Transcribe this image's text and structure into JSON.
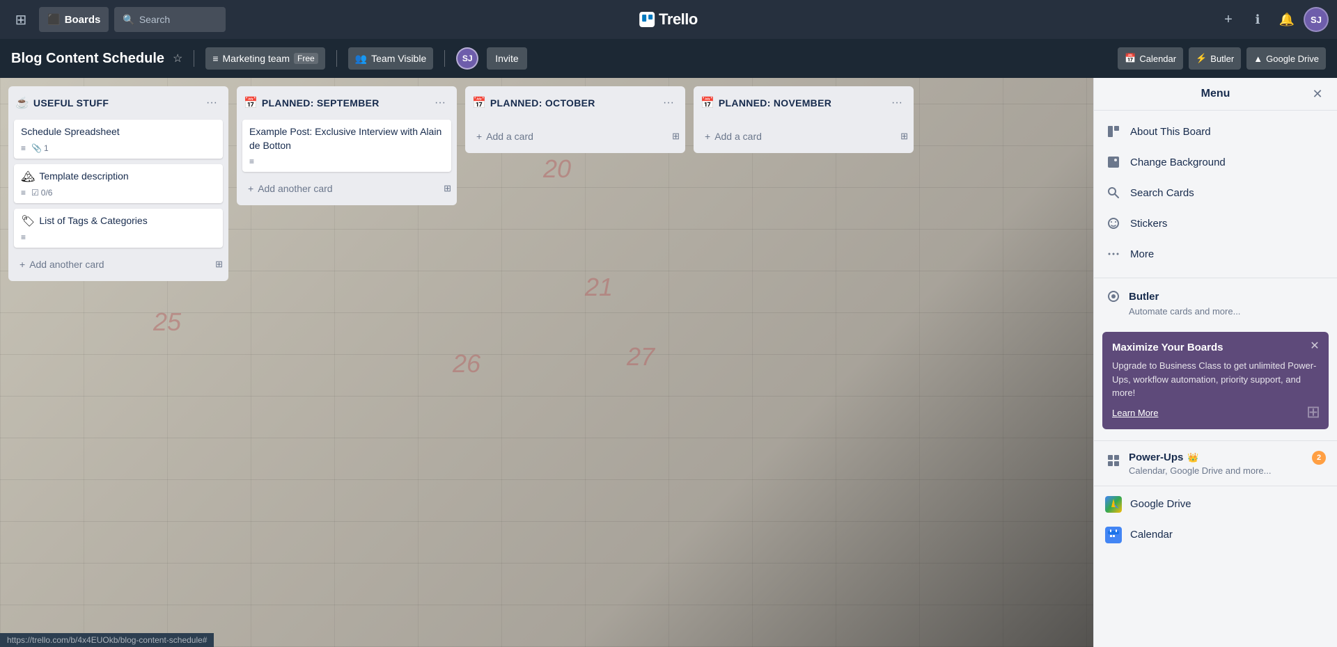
{
  "app": {
    "title": "Trello",
    "logo_text": "Trello"
  },
  "topnav": {
    "home_label": "Home",
    "boards_label": "Boards",
    "search_placeholder": "Search",
    "create_label": "+",
    "info_label": "ℹ",
    "notification_label": "🔔",
    "avatar_initials": "SJ"
  },
  "board": {
    "title": "Blog Content Schedule",
    "team_name": "Marketing team",
    "team_plan": "Free",
    "visibility": "Team Visible",
    "member_initials": "SJ",
    "invite_label": "Invite",
    "powerups": [
      {
        "label": "Calendar"
      },
      {
        "label": "Butler"
      },
      {
        "label": "Google Drive"
      }
    ]
  },
  "lists": [
    {
      "id": "useful-stuff",
      "icon": "☕",
      "title": "USEFUL STUFF",
      "cards": [
        {
          "id": "schedule-spreadsheet",
          "title": "Schedule Spreadsheet",
          "meta_icon_1": "≡",
          "meta_icon_2": "📎",
          "meta_count": "1"
        },
        {
          "id": "template-description",
          "icon": "🏔",
          "title": "Template description",
          "meta_icon_1": "≡",
          "meta_checklist": "0/6"
        },
        {
          "id": "list-of-tags",
          "icon": "🏷",
          "title": "List of Tags & Categories",
          "meta_icon_1": "≡"
        }
      ],
      "add_label": "Add another card"
    },
    {
      "id": "planned-sep",
      "icon": "📅",
      "title": "PLANNED: SEPTEMBER",
      "cards": [
        {
          "id": "example-post",
          "title": "Example Post: Exclusive Interview with Alain de Botton",
          "meta_icon_1": "≡"
        }
      ],
      "add_label": "Add another card"
    },
    {
      "id": "planned-oct",
      "icon": "📅",
      "title": "PLANNED: OCTOBER",
      "cards": [],
      "add_label": "Add a card"
    },
    {
      "id": "planned-nov",
      "icon": "📅",
      "title": "PLANNED: NOVEMBER",
      "cards": [],
      "add_label": "Add a card"
    }
  ],
  "menu": {
    "title": "Menu",
    "close_label": "✕",
    "items": [
      {
        "id": "about-board",
        "icon": "⬜",
        "label": "About This Board"
      },
      {
        "id": "change-background",
        "icon": "🖼",
        "label": "Change Background"
      },
      {
        "id": "search-cards",
        "icon": "🔍",
        "label": "Search Cards"
      },
      {
        "id": "stickers",
        "icon": "😊",
        "label": "Stickers"
      },
      {
        "id": "more",
        "icon": "···",
        "label": "More"
      }
    ],
    "butler": {
      "icon": "⚡",
      "label": "Butler",
      "description": "Automate cards and more..."
    },
    "upgrade": {
      "title": "Maximize Your Boards",
      "description": "Upgrade to Business Class to get unlimited Power-Ups, workflow automation, priority support, and more!",
      "link": "Learn More"
    },
    "powerups": {
      "icon": "⚡",
      "label": "Power-Ups",
      "crown": "👑",
      "badge": "2",
      "description": "Calendar, Google Drive and more..."
    },
    "services": [
      {
        "id": "google-drive",
        "icon": "▲",
        "label": "Google Drive",
        "color": "#34a853"
      },
      {
        "id": "calendar",
        "icon": "📅",
        "label": "Calendar",
        "color": "#4285f4"
      }
    ]
  },
  "statusbar": {
    "url": "https://trello.com/b/4x4EUOkb/blog-content-schedule#"
  }
}
